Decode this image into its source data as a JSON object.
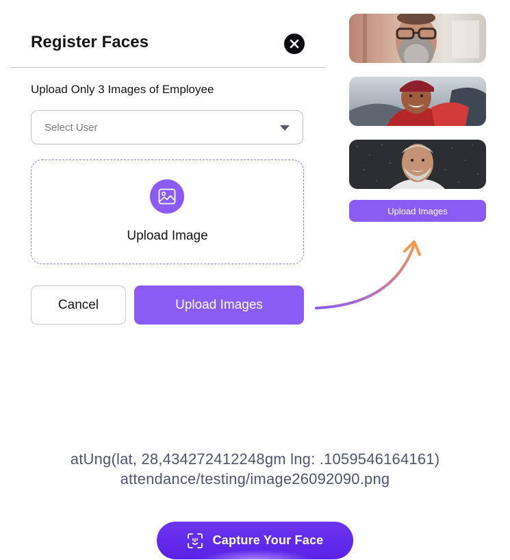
{
  "dialog": {
    "title": "Register Faces",
    "subtitle": "Upload Only 3 Images of Employee",
    "select_placeholder": "Select User",
    "dropzone_label": "Upload Image",
    "cancel_label": "Cancel",
    "upload_label": "Upload Images"
  },
  "preview": {
    "thumbnails": [
      {
        "icon": "person-photo"
      },
      {
        "icon": "person-photo"
      },
      {
        "icon": "person-photo"
      }
    ],
    "upload_label": "Upload Images"
  },
  "meta": {
    "location_line": "atUng(lat, 28,434272412248gm lng: .1059546164161)",
    "path_line": "attendance/testing/image26092090.png"
  },
  "capture": {
    "label": "Capture Your Face",
    "icon": "face-scan-icon"
  },
  "colors": {
    "accent": "#8a5cf5",
    "capture": "#5f28ea",
    "arrow_start": "#8a5cf5",
    "arrow_end": "#f2994a",
    "meta_text": "#4f5471"
  }
}
